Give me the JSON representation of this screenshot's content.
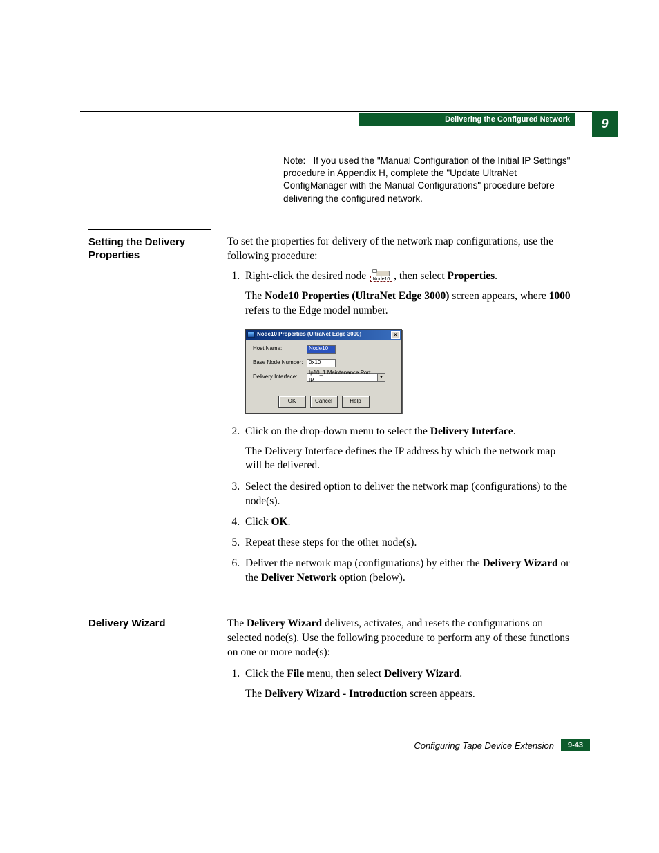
{
  "chapter_number": "9",
  "header_title": "Delivering the Configured Network",
  "note": {
    "label": "Note:",
    "text": "If you used the \"Manual Configuration of the Initial IP Settings\" procedure in Appendix H, complete the \"Update UltraNet ConfigManager with the Manual Configurations\" procedure before delivering the configured network."
  },
  "section1": {
    "title": "Setting the Delivery Properties",
    "intro": "To set the properties for delivery of the network map configurations, use the following procedure:",
    "step1_a": "Right-click the desired node ",
    "step1_b": ", then select ",
    "step1_bold": "Properties",
    "step1_c": ".",
    "node_icon_label": "Node10",
    "step1_result_a": "The ",
    "step1_result_bold1": "Node10 Properties (UltraNet Edge 3000)",
    "step1_result_b": " screen appears, where ",
    "step1_result_bold2": "1000",
    "step1_result_c": " refers to the Edge model number.",
    "dialog": {
      "title": "Node10 Properties (UltraNet Edge 3000)",
      "host_name_label": "Host Name:",
      "host_name_value": "Node10",
      "base_node_label": "Base Node Number:",
      "base_node_value": "0x10",
      "delivery_iface_label": "Delivery Interface:",
      "delivery_iface_value": "Ip10_1 Maintenance Port IP",
      "ok": "OK",
      "cancel": "Cancel",
      "help": "Help"
    },
    "step2_a": "Click on the drop-down menu to select the ",
    "step2_bold": "Delivery Interface",
    "step2_b": ".",
    "step2_result": "The Delivery Interface defines the IP address by which the network map will be delivered.",
    "step3": "Select the desired option to deliver the network map (configurations) to the node(s).",
    "step4_a": "Click ",
    "step4_bold": "OK",
    "step4_b": ".",
    "step5": "Repeat these steps for the other node(s).",
    "step6_a": "Deliver the network map (configurations) by either the ",
    "step6_bold1": "Delivery Wizard",
    "step6_b": " or the ",
    "step6_bold2": "Deliver Network",
    "step6_c": " option (below)."
  },
  "section2": {
    "title": "Delivery Wizard",
    "intro_a": "The ",
    "intro_bold": "Delivery Wizard",
    "intro_b": " delivers, activates, and resets the configurations on selected node(s). Use the following procedure to perform any of these functions on one or more node(s):",
    "step1_a": "Click the ",
    "step1_bold1": "File",
    "step1_b": " menu, then select ",
    "step1_bold2": "Delivery Wizard",
    "step1_c": ".",
    "step1_result_a": "The ",
    "step1_result_bold": "Delivery Wizard - Introduction",
    "step1_result_b": " screen appears."
  },
  "footer": {
    "text": "Configuring Tape Device Extension",
    "page": "9-43"
  }
}
